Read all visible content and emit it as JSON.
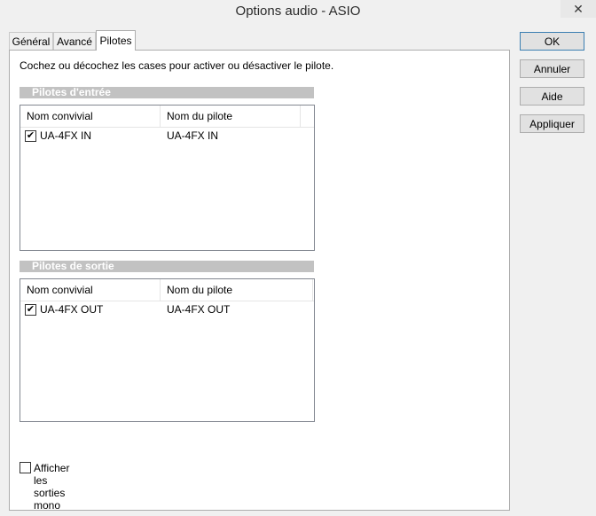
{
  "window": {
    "title": "Options audio - ASIO",
    "close_glyph": "✕"
  },
  "tabs": [
    {
      "label": "Général",
      "active": false
    },
    {
      "label": "Avancé",
      "active": false
    },
    {
      "label": "Pilotes",
      "active": true
    }
  ],
  "panel": {
    "instructions": "Cochez ou décochez les cases pour activer ou désactiver le pilote.",
    "input_group": {
      "title": "Pilotes d'entrée",
      "columns": [
        "Nom convivial",
        "Nom du pilote"
      ],
      "rows": [
        {
          "checked": true,
          "friendly_name": "UA-4FX IN",
          "driver_name": "UA-4FX IN"
        }
      ]
    },
    "output_group": {
      "title": "Pilotes de sortie",
      "columns": [
        "Nom convivial",
        "Nom du pilote"
      ],
      "rows": [
        {
          "checked": true,
          "friendly_name": "UA-4FX OUT",
          "driver_name": "UA-4FX OUT"
        }
      ]
    },
    "mono_option": {
      "label": "Afficher les sorties mono",
      "checked": false
    }
  },
  "buttons": {
    "ok": "OK",
    "cancel": "Annuler",
    "help": "Aide",
    "apply": "Appliquer"
  },
  "check_glyph": "✔"
}
